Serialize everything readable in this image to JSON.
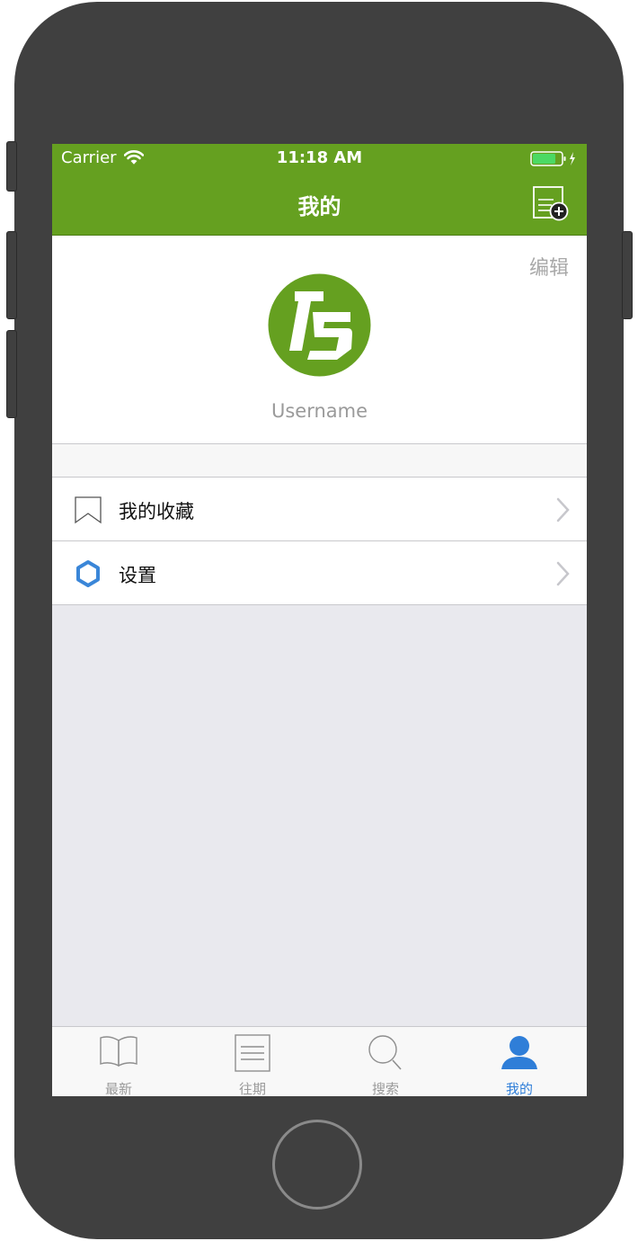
{
  "status_bar": {
    "carrier": "Carrier",
    "time": "11:18 AM",
    "battery_color": "#4cd964"
  },
  "nav": {
    "title": "我的",
    "bar_color": "#65a020",
    "right_icon": "compose-icon"
  },
  "profile": {
    "edit_label": "编辑",
    "username": "Username",
    "avatar_color": "#65a020"
  },
  "menu": {
    "items": [
      {
        "label": "我的收藏",
        "icon": "bookmark-icon"
      },
      {
        "label": "设置",
        "icon": "gear-icon"
      }
    ]
  },
  "tabbar": {
    "active_color": "#2f7ed8",
    "inactive_color": "#9a9a9a",
    "items": [
      {
        "label": "最新",
        "icon": "book-icon",
        "active": false
      },
      {
        "label": "往期",
        "icon": "list-icon",
        "active": false
      },
      {
        "label": "搜索",
        "icon": "search-icon",
        "active": false
      },
      {
        "label": "我的",
        "icon": "person-icon",
        "active": true
      }
    ]
  }
}
